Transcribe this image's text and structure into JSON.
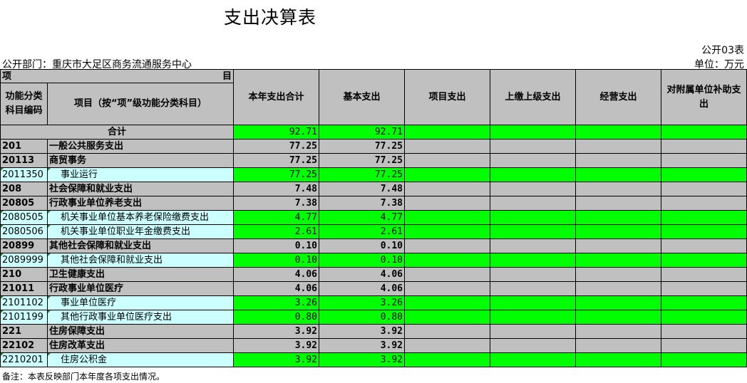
{
  "title": "支出决算表",
  "form_no": "公开03表",
  "dept": "公开部门：重庆市大足区商务流通服务中心",
  "unit": "单位：万元",
  "note": "备注：本表反映部门本年度各项支出情况。",
  "header": {
    "xiang": "项",
    "mu": "目",
    "code": "功能分类科目编码",
    "name": "项目（按“项”级功能分类科目）",
    "total": "本年支出合计",
    "basic": "基本支出",
    "project": "项目支出",
    "upper": "上缴上级支出",
    "operating": "经营支出",
    "subsidy": "对附属单位补助支出"
  },
  "total_row": {
    "label": "合计",
    "total": "92.71",
    "basic": "92.71"
  },
  "rows": [
    {
      "code": "201",
      "name": "一般公共服务支出",
      "total": "77.25",
      "basic": "77.25",
      "level": 1
    },
    {
      "code": "20113",
      "name": "商贸事务",
      "total": "77.25",
      "basic": "77.25",
      "level": 2
    },
    {
      "code": "2011350",
      "name": "事业运行",
      "total": "77.25",
      "basic": "77.25",
      "level": 3
    },
    {
      "code": "208",
      "name": "社会保障和就业支出",
      "total": "7.48",
      "basic": "7.48",
      "level": 1
    },
    {
      "code": "20805",
      "name": "行政事业单位养老支出",
      "total": "7.38",
      "basic": "7.38",
      "level": 2
    },
    {
      "code": "2080505",
      "name": "机关事业单位基本养老保险缴费支出",
      "total": "4.77",
      "basic": "4.77",
      "level": 3
    },
    {
      "code": "2080506",
      "name": "机关事业单位职业年金缴费支出",
      "total": "2.61",
      "basic": "2.61",
      "level": 3
    },
    {
      "code": "20899",
      "name": "其他社会保障和就业支出",
      "total": "0.10",
      "basic": "0.10",
      "level": 2
    },
    {
      "code": "2089999",
      "name": "其他社会保障和就业支出",
      "total": "0.10",
      "basic": "0.10",
      "level": 3
    },
    {
      "code": "210",
      "name": "卫生健康支出",
      "total": "4.06",
      "basic": "4.06",
      "level": 1
    },
    {
      "code": "21011",
      "name": "行政事业单位医疗",
      "total": "4.06",
      "basic": "4.06",
      "level": 2
    },
    {
      "code": "2101102",
      "name": "事业单位医疗",
      "total": "3.26",
      "basic": "3.26",
      "level": 3
    },
    {
      "code": "2101199",
      "name": "其他行政事业单位医疗支出",
      "total": "0.80",
      "basic": "0.80",
      "level": 3
    },
    {
      "code": "221",
      "name": "住房保障支出",
      "total": "3.92",
      "basic": "3.92",
      "level": 1
    },
    {
      "code": "22102",
      "name": "住房改革支出",
      "total": "3.92",
      "basic": "3.92",
      "level": 2
    },
    {
      "code": "2210201",
      "name": "住房公积金",
      "total": "3.92",
      "basic": "3.92",
      "level": 3
    }
  ],
  "colors": {
    "gray": "#c0c0c0",
    "cyan": "#ccffff",
    "green": "#00ff00"
  }
}
